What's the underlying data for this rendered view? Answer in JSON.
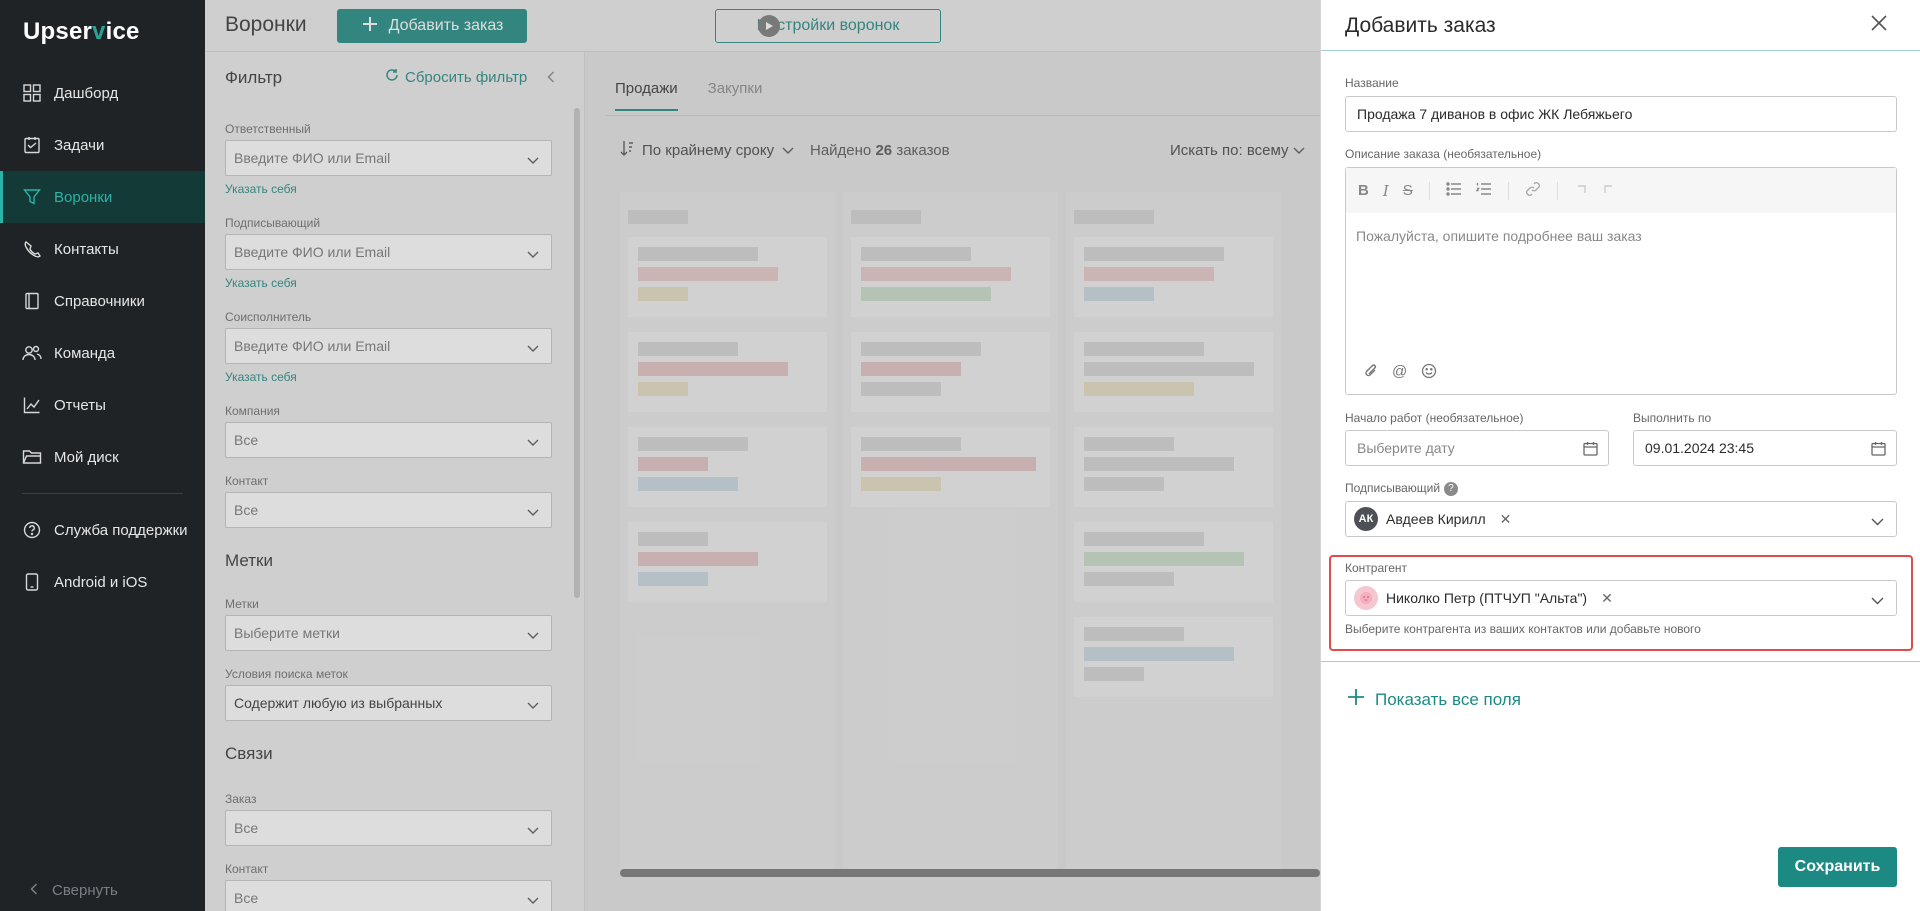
{
  "app": {
    "logo_a": "Upser",
    "logo_b": "v",
    "logo_c": "ice"
  },
  "sidebar": {
    "items": [
      {
        "label": "Дашборд",
        "icon": "dashboard-icon"
      },
      {
        "label": "Задачи",
        "icon": "tasks-icon"
      },
      {
        "label": "Воронки",
        "icon": "funnel-icon",
        "active": true
      },
      {
        "label": "Контакты",
        "icon": "contacts-icon"
      },
      {
        "label": "Справочники",
        "icon": "book-icon"
      },
      {
        "label": "Команда",
        "icon": "team-icon"
      },
      {
        "label": "Отчеты",
        "icon": "reports-icon"
      },
      {
        "label": "Мой диск",
        "icon": "folder-icon"
      }
    ],
    "bottom_items": [
      {
        "label": "Служба поддержки",
        "icon": "help-icon"
      },
      {
        "label": "Android и iOS",
        "icon": "phone-icon"
      }
    ],
    "collapse_label": "Свернуть"
  },
  "header": {
    "title": "Воронки",
    "add_order": "Добавить заказ",
    "funnel_settings": "Настройки воронок"
  },
  "filter": {
    "title": "Фильтр",
    "reset": "Сбросить фильтр",
    "set_self": "Указать себя",
    "responsible": {
      "label": "Ответственный",
      "placeholder": "Введите ФИО или Email"
    },
    "signer": {
      "label": "Подписывающий",
      "placeholder": "Введите ФИО или Email"
    },
    "coexecutor": {
      "label": "Соисполнитель",
      "placeholder": "Введите ФИО или Email"
    },
    "company": {
      "label": "Компания",
      "value": "Все"
    },
    "contact": {
      "label": "Контакт",
      "value": "Все"
    },
    "tags_section": "Метки",
    "tags": {
      "label": "Метки",
      "placeholder": "Выберите метки"
    },
    "tag_conditions": {
      "label": "Условия поиска меток",
      "value": "Содержит любую из выбранных"
    },
    "links_section": "Связи",
    "order": {
      "label": "Заказ",
      "value": "Все"
    },
    "contact2": {
      "label": "Контакт",
      "value": "Все"
    }
  },
  "board": {
    "tabs": [
      {
        "label": "Продажи",
        "active": true
      },
      {
        "label": "Закупки",
        "active": false
      }
    ],
    "sort": "По крайнему сроку",
    "found_prefix": "Найдено",
    "found_count": "26",
    "found_suffix": "заказов",
    "search_by": "Искать по: всему"
  },
  "drawer": {
    "title": "Добавить заказ",
    "name_label": "Название",
    "name_value": "Продажа 7 диванов в офис ЖК Лебяжьего",
    "desc_label": "Описание заказа (необязательное)",
    "desc_placeholder": "Пожалуйста, опишите подробнее ваш заказ",
    "start_label": "Начало работ (необязательное)",
    "start_placeholder": "Выберите дату",
    "due_label": "Выполнить по",
    "due_value": "09.01.2024 23:45",
    "signer_label": "Подписывающий",
    "signer_initials": "АК",
    "signer_name": "Авдеев Кирилл",
    "counterparty_label": "Контрагент",
    "counterparty_name": "Николко Петр (ПТЧУП \"Альта\")",
    "counterparty_hint": "Выберите контрагента из ваших контактов или добавьте нового",
    "show_all": "Показать все поля",
    "save": "Сохранить"
  }
}
